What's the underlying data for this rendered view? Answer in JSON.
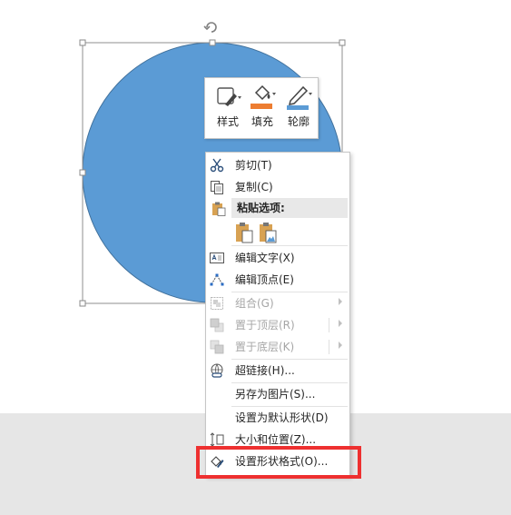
{
  "mini_toolbar": {
    "style_label": "样式",
    "fill_label": "填充",
    "outline_label": "轮廓"
  },
  "context_menu": {
    "cut": "剪切(T)",
    "copy": "复制(C)",
    "paste_options": "粘贴选项:",
    "edit_text": "编辑文字(X)",
    "edit_points": "编辑顶点(E)",
    "group": "组合(G)",
    "bring_to_front": "置于顶层(R)",
    "send_to_back": "置于底层(K)",
    "hyperlink": "超链接(H)...",
    "save_as_picture": "另存为图片(S)...",
    "set_default_shape": "设置为默认形状(D)",
    "size_position": "大小和位置(Z)...",
    "format_shape": "设置形状格式(O)..."
  },
  "colors": {
    "shape_fill": "#5b9bd5",
    "shape_stroke": "#41719c",
    "fill_swatch": "#ed7d31",
    "outline_swatch": "#5b9bd5",
    "highlight": "#ee3030",
    "slide_background": "#e6e6e6"
  },
  "icons": [
    "rotate-handle-icon",
    "shape-style-icon",
    "fill-bucket-icon",
    "outline-pen-icon",
    "scissors-icon",
    "copy-icon",
    "paste-icon",
    "paste-keep-icon",
    "paste-picture-icon",
    "edit-text-icon",
    "edit-points-icon",
    "group-icon",
    "bring-front-icon",
    "send-back-icon",
    "hyperlink-icon",
    "size-position-icon",
    "format-shape-icon",
    "submenu-arrow-icon"
  ]
}
